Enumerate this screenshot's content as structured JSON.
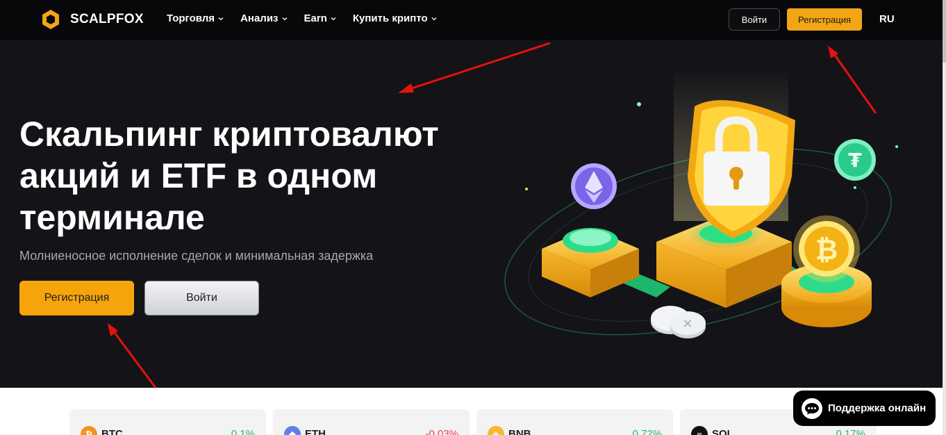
{
  "header": {
    "brand": "SCALPFOX",
    "nav": [
      {
        "label": "Торговля"
      },
      {
        "label": "Анализ"
      },
      {
        "label": "Earn"
      },
      {
        "label": "Купить крипто"
      }
    ],
    "login_label": "Войти",
    "register_label": "Регистрация",
    "language": "RU"
  },
  "hero": {
    "title": "Скальпинг криптовалют акций и ETF в одном терминале",
    "subtitle": "Молниеносное исполнение сделок и минимальная задержка",
    "register_label": "Регистрация",
    "login_label": "Войти"
  },
  "tickers": [
    {
      "symbol": "BTC",
      "change": "0.1%",
      "direction": "up",
      "icon": "bitcoin-icon"
    },
    {
      "symbol": "ETH",
      "change": "-0.03%",
      "direction": "down",
      "icon": "ethereum-icon"
    },
    {
      "symbol": "BNB",
      "change": "0.72%",
      "direction": "up",
      "icon": "bnb-icon"
    },
    {
      "symbol": "SOL",
      "change": "0.17%",
      "direction": "up",
      "icon": "solana-icon"
    }
  ],
  "support": {
    "label": "Поддержка онлайн"
  },
  "colors": {
    "accent": "#f5a50a",
    "header_bg": "#08080a",
    "hero_bg": "#141318",
    "positive": "#1fb87a",
    "negative": "#e8454b",
    "annotation": "#e4120f"
  }
}
